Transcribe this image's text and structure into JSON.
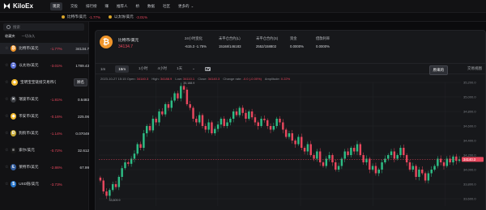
{
  "brand": {
    "name": "KiloEx"
  },
  "nav": {
    "items": [
      {
        "label": "现货",
        "active": true
      },
      {
        "label": "交投",
        "active": false
      },
      {
        "label": "排行榜",
        "active": false
      },
      {
        "label": "赚",
        "active": false
      },
      {
        "label": "推荐人",
        "active": false
      },
      {
        "label": "桥",
        "active": false
      },
      {
        "label": "数据",
        "active": false
      },
      {
        "label": "社区",
        "active": false
      },
      {
        "label": "更多的",
        "active": false
      }
    ],
    "more_chevron": "chevron-down-icon"
  },
  "ticker_strip": [
    {
      "symbol": "比特币/美元",
      "change": "-1.77%"
    },
    {
      "symbol": "以太坊/美元",
      "change": "-3.01%"
    }
  ],
  "sidebar": {
    "search_placeholder": "搜索",
    "tabs": [
      {
        "label": "收藏夹",
        "active": true
      },
      {
        "label": "一切永久",
        "active": false
      }
    ],
    "pairs": [
      {
        "name": "比特币/美元",
        "change": "-1.77%",
        "price": "34134.7",
        "coin_color": "#f0952a",
        "coin_glyph": "₿",
        "selected": true
      },
      {
        "name": "以太坊/美元",
        "change": "-3.01%",
        "price": "1789.43",
        "coin_color": "#5a6fd6",
        "coin_glyph": "Ξ",
        "selected": false
      },
      {
        "name": "宝明宝宝链接交易所/美元",
        "change": "",
        "price": "",
        "badge": "顾名",
        "coin_color": "#f3ba2f",
        "coin_glyph": "◆",
        "selected": false
      },
      {
        "name": "瑞波币/美元",
        "change": "-1.81%",
        "price": "0.5483",
        "coin_color": "#3b3d42",
        "coin_glyph": "✕",
        "selected": false
      },
      {
        "name": "币安币/美元",
        "change": "-0.16%",
        "price": "225.06",
        "coin_color": "#f3ba2f",
        "coin_glyph": "◆",
        "selected": false
      },
      {
        "name": "狗狗币/美元",
        "change": "-1.14%",
        "price": "0.07049",
        "coin_color": "#c2a633",
        "coin_glyph": "Ð",
        "selected": false
      },
      {
        "name": "索尔/美元",
        "change": "-0.72%",
        "price": "32.612",
        "coin_color": "#1a1a1a",
        "coin_glyph": "≡",
        "selected": false
      },
      {
        "name": "莱特币/美元",
        "change": "-2.86%",
        "price": "67.99",
        "coin_color": "#345d9d",
        "coin_glyph": "Ł",
        "selected": false
      },
      {
        "name": "USD链/美元",
        "change": "-3.73%",
        "price": "",
        "coin_color": "#2775ca",
        "coin_glyph": "$",
        "selected": false
      }
    ]
  },
  "header": {
    "pair": "比特币/美元",
    "price": "34134.7",
    "stats": [
      {
        "label": "24小时变化",
        "value": "-615.3  -1.75%",
        "negative": true
      },
      {
        "label": "未平仓合约(L)",
        "value": "15168/146183",
        "negative": false
      },
      {
        "label": "未平仓合约(S)",
        "value": "2552/158802",
        "negative": false
      },
      {
        "label": "资金",
        "value": "0.0000%",
        "negative": false
      },
      {
        "label": "借款利率",
        "value": "0.0000%",
        "negative": false
      }
    ]
  },
  "timeframes": {
    "items": [
      {
        "label": "1m",
        "active": false
      },
      {
        "label": "15m",
        "active": true
      },
      {
        "label": "1小时",
        "active": false
      },
      {
        "label": "4小时",
        "active": false
      },
      {
        "label": "1天",
        "active": false
      },
      {
        "label": "⌄",
        "active": false
      }
    ],
    "screenshot_icon": "camera-icon",
    "view_original": "原来的",
    "view_trading": "交易视图"
  },
  "ohlc": {
    "datetime": "2023-10-27 15:15",
    "open_label": "Open:",
    "open": "34140.3",
    "high_label": "High:",
    "high": "34188.9",
    "low_label": "Low:",
    "low": "34110.1",
    "close_label": "Close:",
    "close": "34140.3",
    "change_label": "Change rate:",
    "change": "-0.0 (-0.00%)",
    "amp_label": "Amplitude:",
    "amp": "0.22%"
  },
  "chart_data": {
    "type": "candlestick",
    "title": "",
    "xlabel": "",
    "ylabel": "",
    "ylim": [
      33500,
      35200
    ],
    "y_ticks": [
      "35,200.0",
      "35,000.0",
      "34,800.0",
      "34,600.0",
      "34,400.0",
      "34,200.0",
      "34,000.0",
      "33,800.0",
      "33,600.0"
    ],
    "x_ticks": [
      "01:00",
      "04:00",
      "08:00",
      "12:00",
      "16:00"
    ],
    "current_price": "34140.3",
    "high_annotation": "35,188.9",
    "low_annotation": "33,609.9",
    "colors": {
      "up": "#2ebd85",
      "down": "#e8475d",
      "grid": "#232428"
    },
    "closes": [
      33850,
      33700,
      33640,
      33720,
      33800,
      33760,
      33900,
      34020,
      34100,
      34080,
      34150,
      34220,
      34350,
      34300,
      34500,
      34600,
      34540,
      34700,
      34650,
      34800,
      34760,
      34900,
      34850,
      34950,
      35050,
      34980,
      35150,
      35100,
      34900,
      34850,
      34700,
      34650,
      34750,
      34600,
      34550,
      34650,
      34500,
      34560,
      34620,
      34700,
      34600,
      34650,
      34700,
      34800,
      34750,
      34850,
      34780,
      34700,
      34800,
      34720,
      34650,
      34600,
      34700,
      34680,
      34600,
      34550,
      34600,
      34700,
      34650,
      34550,
      34450,
      34500,
      34400,
      34350,
      34450,
      34300,
      34250,
      34350,
      34200,
      34150,
      34250,
      34100,
      34050,
      34150,
      34200,
      34100,
      34000,
      34050,
      34150,
      34250,
      34200,
      34300,
      34250,
      34350,
      34200,
      34100,
      34150,
      34000,
      34050,
      33950,
      34000,
      34100,
      34150,
      34200,
      34250,
      34150,
      34200,
      34300,
      34200,
      34100,
      34000,
      34050,
      33900,
      34000,
      33950,
      33850,
      33950,
      34000,
      34050,
      34150,
      34100,
      34050,
      34150,
      34100,
      34180,
      34120,
      34140
    ]
  }
}
